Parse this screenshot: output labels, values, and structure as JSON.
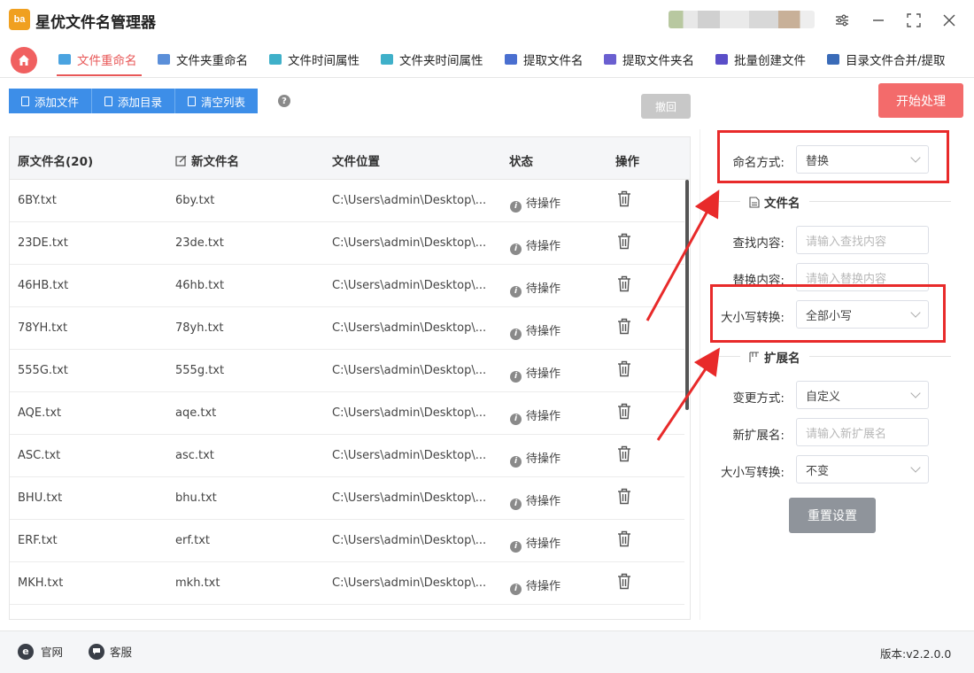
{
  "app": {
    "logo_text": "ba",
    "title": "星优文件名管理器"
  },
  "window_controls": [
    "settings-sliders",
    "minimize",
    "maximize",
    "close"
  ],
  "tabs": [
    {
      "label": "文件重命名",
      "active": true,
      "icon_color": "#4aa3e0"
    },
    {
      "label": "文件夹重命名",
      "active": false,
      "icon_color": "#5b8fd9"
    },
    {
      "label": "文件时间属性",
      "active": false,
      "icon_color": "#3fb0c9"
    },
    {
      "label": "文件夹时间属性",
      "active": false,
      "icon_color": "#3fb0c9"
    },
    {
      "label": "提取文件名",
      "active": false,
      "icon_color": "#4a6fd0"
    },
    {
      "label": "提取文件夹名",
      "active": false,
      "icon_color": "#6a5fd0"
    },
    {
      "label": "批量创建文件",
      "active": false,
      "icon_color": "#5a4ec8"
    },
    {
      "label": "目录文件合并/提取",
      "active": false,
      "icon_color": "#3a6bb8"
    }
  ],
  "toolbar": {
    "add_file": "添加文件",
    "add_dir": "添加目录",
    "clear_list": "清空列表",
    "help": "?",
    "undo": "撤回",
    "start": "开始处理"
  },
  "table": {
    "headers": {
      "original": "原文件名(20)",
      "new": "新文件名",
      "location": "文件位置",
      "status": "状态",
      "action": "操作"
    },
    "rows": [
      {
        "original": "6BY.txt",
        "new": "6by.txt",
        "location": "C:\\Users\\admin\\Desktop\\...",
        "status": "待操作"
      },
      {
        "original": "23DE.txt",
        "new": "23de.txt",
        "location": "C:\\Users\\admin\\Desktop\\...",
        "status": "待操作"
      },
      {
        "original": "46HB.txt",
        "new": "46hb.txt",
        "location": "C:\\Users\\admin\\Desktop\\...",
        "status": "待操作"
      },
      {
        "original": "78YH.txt",
        "new": "78yh.txt",
        "location": "C:\\Users\\admin\\Desktop\\...",
        "status": "待操作"
      },
      {
        "original": "555G.txt",
        "new": "555g.txt",
        "location": "C:\\Users\\admin\\Desktop\\...",
        "status": "待操作"
      },
      {
        "original": "AQE.txt",
        "new": "aqe.txt",
        "location": "C:\\Users\\admin\\Desktop\\...",
        "status": "待操作"
      },
      {
        "original": "ASC.txt",
        "new": "asc.txt",
        "location": "C:\\Users\\admin\\Desktop\\...",
        "status": "待操作"
      },
      {
        "original": "BHU.txt",
        "new": "bhu.txt",
        "location": "C:\\Users\\admin\\Desktop\\...",
        "status": "待操作"
      },
      {
        "original": "ERF.txt",
        "new": "erf.txt",
        "location": "C:\\Users\\admin\\Desktop\\...",
        "status": "待操作"
      },
      {
        "original": "MKH.txt",
        "new": "mkh.txt",
        "location": "C:\\Users\\admin\\Desktop\\...",
        "status": "待操作"
      }
    ]
  },
  "panel": {
    "naming_method_label": "命名方式:",
    "naming_method_value": "替换",
    "filename_section": "文件名",
    "find_label": "查找内容:",
    "find_placeholder": "请输入查找内容",
    "replace_label": "替换内容:",
    "replace_placeholder": "请输入替换内容",
    "case_label": "大小写转换:",
    "case_value": "全部小写",
    "ext_section": "扩展名",
    "change_label": "变更方式:",
    "change_value": "自定义",
    "new_ext_label": "新扩展名:",
    "new_ext_placeholder": "请输入新扩展名",
    "ext_case_label": "大小写转换:",
    "ext_case_value": "不变",
    "reset": "重置设置"
  },
  "footer": {
    "website": "官网",
    "service": "客服",
    "version_label": "版本:",
    "version": "v2.2.0.0"
  },
  "colors": {
    "accent_red": "#e85858",
    "primary_blue": "#3d8ee8",
    "annotation_red": "#e82a2a"
  }
}
